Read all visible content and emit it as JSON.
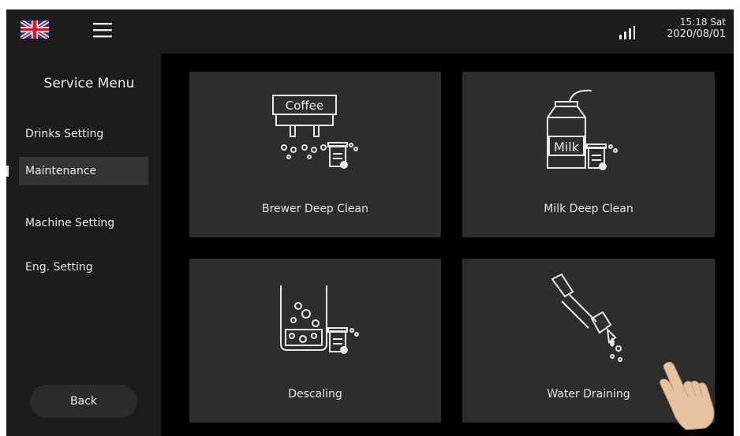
{
  "status_bar": {
    "time": "15:18 Sat",
    "date": "2020/08/01",
    "language_flag": "uk-flag-icon",
    "menu_icon": "hamburger-menu-icon",
    "signal_icon": "signal-strength-icon"
  },
  "sidebar": {
    "title": "Service Menu",
    "items": [
      {
        "label": "Drinks Setting",
        "active": false
      },
      {
        "label": "Maintenance",
        "active": true
      },
      {
        "label": "Machine Setting",
        "active": false
      },
      {
        "label": "Eng. Setting",
        "active": false
      }
    ],
    "back_label": "Back"
  },
  "tiles": [
    {
      "label": "Brewer Deep Clean",
      "icon": "coffee-brewer-clean-icon",
      "icon_text": "Coffee"
    },
    {
      "label": "Milk Deep Clean",
      "icon": "milk-carton-clean-icon",
      "icon_text": "Milk"
    },
    {
      "label": "Descaling",
      "icon": "descaling-container-icon"
    },
    {
      "label": "Water Draining",
      "icon": "water-drain-pipe-icon"
    }
  ],
  "colors": {
    "screen_background": "#000000",
    "panel_background": "#1c1c1c",
    "tile_background": "#2d2d2d",
    "active_item_background": "#333333",
    "text": "#e6e6e6"
  }
}
